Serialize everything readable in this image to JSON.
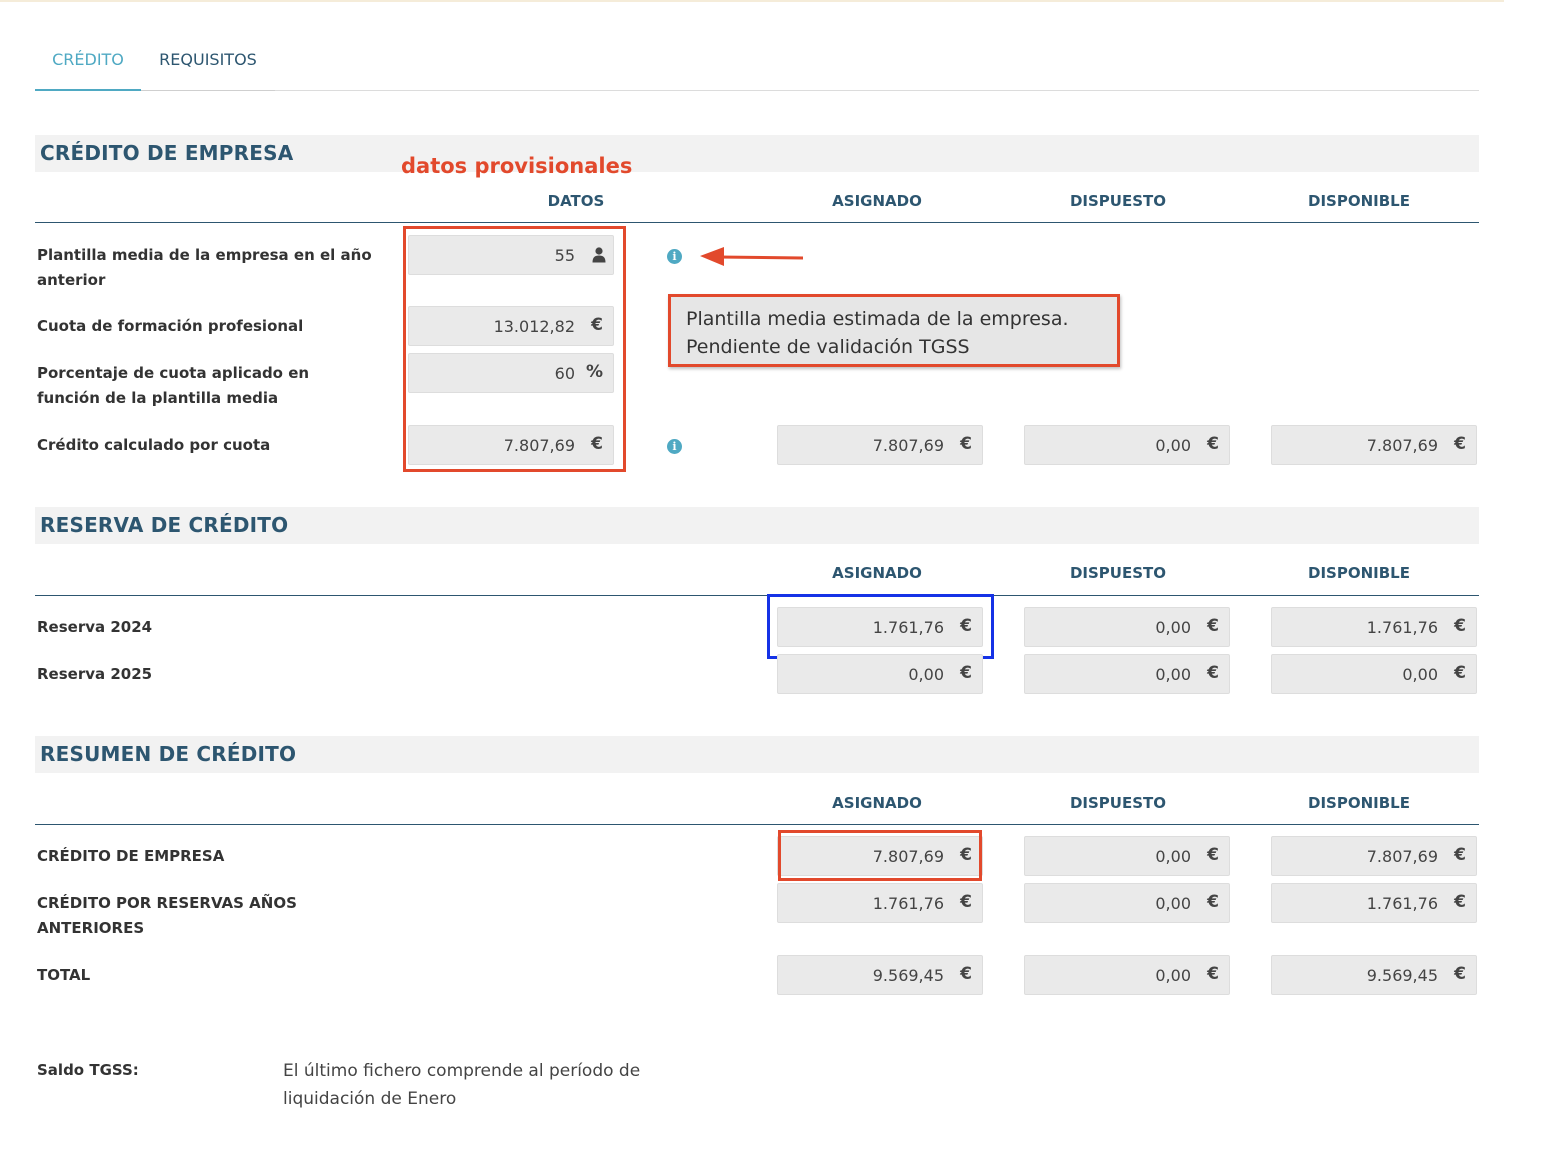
{
  "tabs": [
    {
      "label": "CRÉDITO",
      "active": true
    },
    {
      "label": "REQUISITOS",
      "active": false
    }
  ],
  "annotation": "datos provisionales",
  "tooltip": {
    "line1": "Plantilla media estimada de la empresa.",
    "line2": "Pendiente de validación TGSS"
  },
  "empresa": {
    "title": "CRÉDITO DE EMPRESA",
    "headers": {
      "datos": "DATOS",
      "asignado": "ASIGNADO",
      "dispuesto": "DISPUESTO",
      "disponible": "DISPONIBLE"
    },
    "rows": [
      {
        "label": "Plantilla media de la empresa en el año anterior",
        "datos": "55",
        "unit_icon": "user-icon"
      },
      {
        "label": "Cuota de formación profesional",
        "datos": "13.012,82",
        "unit": "€"
      },
      {
        "label": "Porcentaje de cuota aplicado en función de la plantilla media",
        "datos": "60",
        "unit": "%"
      },
      {
        "label": "Crédito calculado por cuota",
        "datos": "7.807,69",
        "unit": "€",
        "asignado": "7.807,69",
        "dispuesto": "0,00",
        "disponible": "7.807,69"
      }
    ]
  },
  "reserva": {
    "title": "RESERVA DE CRÉDITO",
    "headers": {
      "asignado": "ASIGNADO",
      "dispuesto": "DISPUESTO",
      "disponible": "DISPONIBLE"
    },
    "rows": [
      {
        "label": "Reserva 2024",
        "asignado": "1.761,76",
        "dispuesto": "0,00",
        "disponible": "1.761,76"
      },
      {
        "label": "Reserva 2025",
        "asignado": "0,00",
        "dispuesto": "0,00",
        "disponible": "0,00"
      }
    ]
  },
  "resumen": {
    "title": "RESUMEN DE CRÉDITO",
    "headers": {
      "asignado": "ASIGNADO",
      "dispuesto": "DISPUESTO",
      "disponible": "DISPONIBLE"
    },
    "rows": [
      {
        "label": "CRÉDITO DE EMPRESA",
        "asignado": "7.807,69",
        "dispuesto": "0,00",
        "disponible": "7.807,69"
      },
      {
        "label": "CRÉDITO POR RESERVAS AÑOS ANTERIORES",
        "asignado": "1.761,76",
        "dispuesto": "0,00",
        "disponible": "1.761,76"
      },
      {
        "label": "TOTAL",
        "asignado": "9.569,45",
        "dispuesto": "0,00",
        "disponible": "9.569,45"
      }
    ]
  },
  "currency_symbol": "€",
  "saldo": {
    "label": "Saldo TGSS:",
    "text": "El último fichero comprende al período de liquidación de Enero"
  },
  "colors": {
    "accent": "#4fa9c3",
    "heading": "#2d5670",
    "annotation_red": "#e2492c",
    "annotation_blue": "#1532e6"
  }
}
